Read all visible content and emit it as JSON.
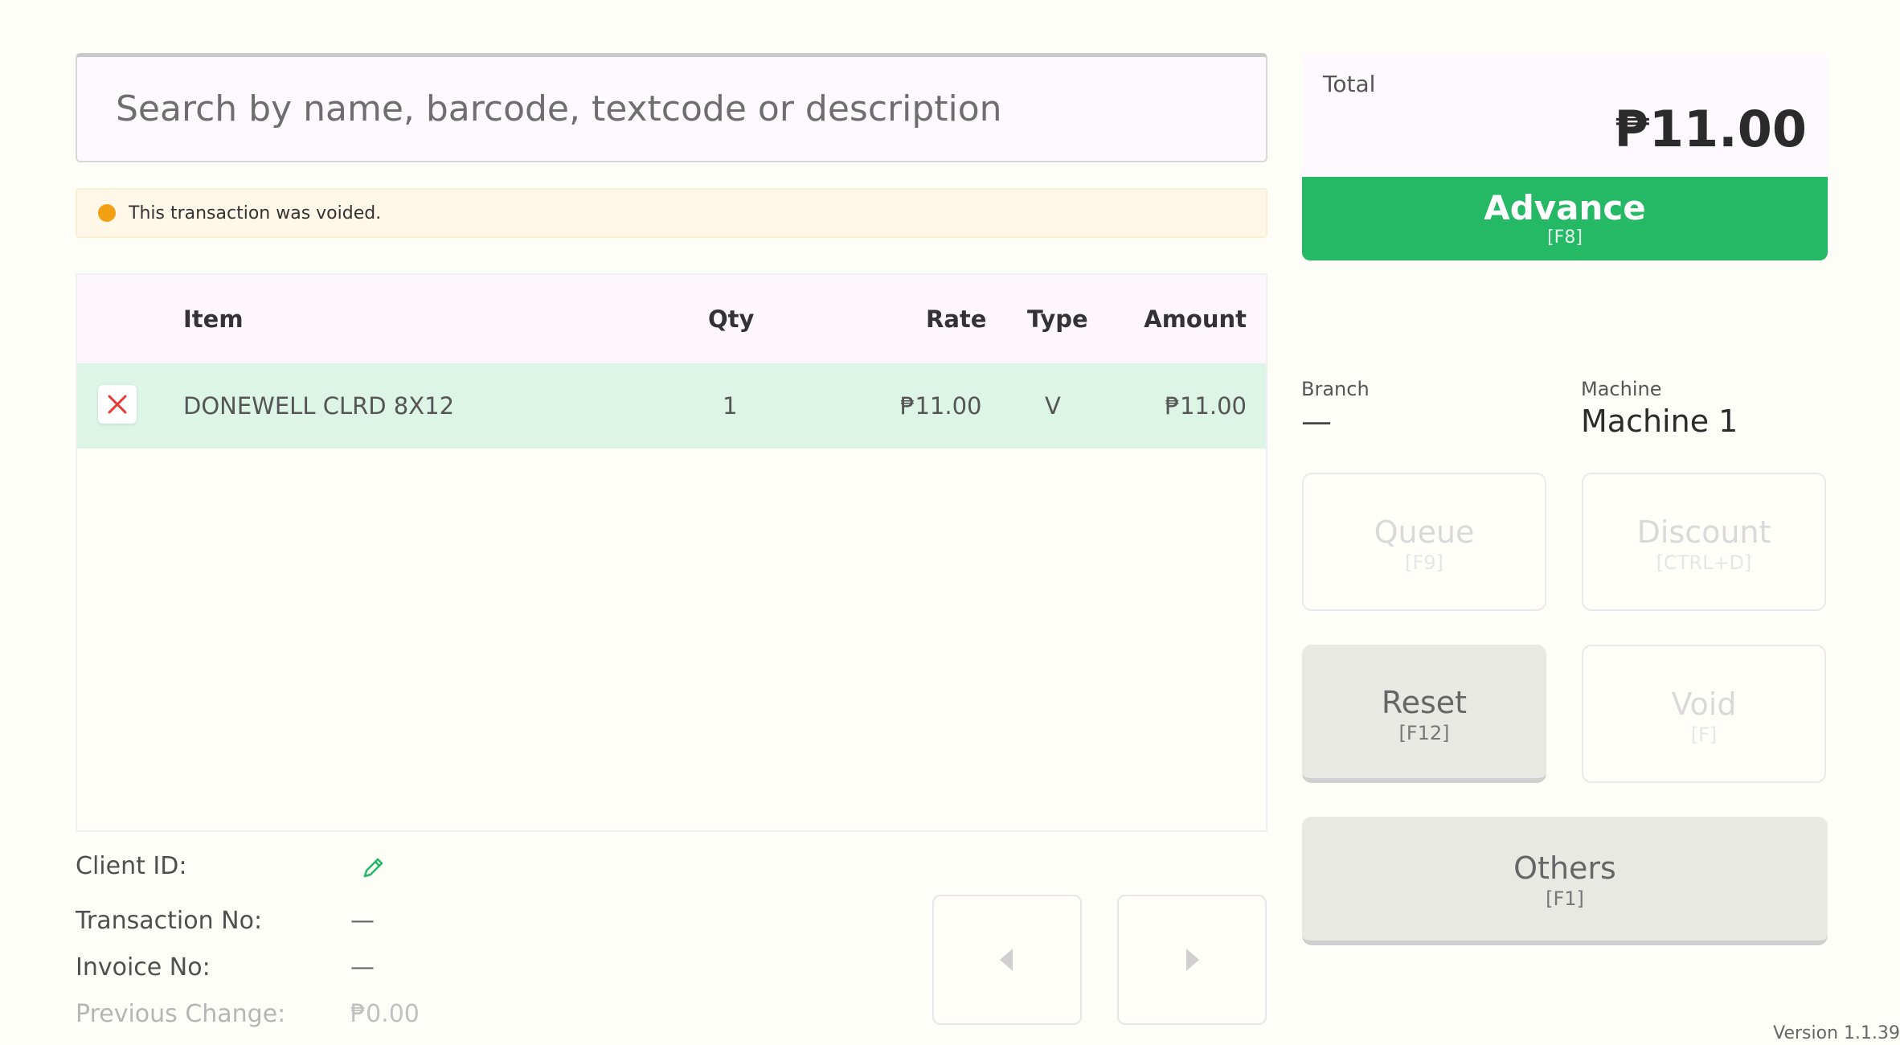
{
  "search": {
    "placeholder": "Search by name, barcode, textcode or description"
  },
  "alert": {
    "text": "This transaction was voided."
  },
  "table": {
    "headers": {
      "item": "Item",
      "qty": "Qty",
      "rate": "Rate",
      "type": "Type",
      "amount": "Amount"
    },
    "rows": [
      {
        "item": "DONEWELL CLRD 8X12",
        "qty": "1",
        "rate": "₱11.00",
        "type": "V",
        "amount": "₱11.00"
      }
    ]
  },
  "client": {
    "client_id_label": "Client ID:",
    "transaction_no_label": "Transaction No:",
    "transaction_no_value": "—",
    "invoice_no_label": "Invoice No:",
    "invoice_no_value": "—",
    "previous_change_label": "Previous Change:",
    "previous_change_value": "₱0.00"
  },
  "summary": {
    "total_label": "Total",
    "total_value": "₱11.00"
  },
  "advance": {
    "label": "Advance",
    "key": "[F8]"
  },
  "meta": {
    "branch_label": "Branch",
    "branch_value": "—",
    "machine_label": "Machine",
    "machine_value": "Machine 1"
  },
  "actions": {
    "queue": {
      "label": "Queue",
      "key": "[F9]"
    },
    "discount": {
      "label": "Discount",
      "key": "[CTRL+D]"
    },
    "reset": {
      "label": "Reset",
      "key": "[F12]"
    },
    "void": {
      "label": "Void",
      "key": "[F]"
    },
    "others": {
      "label": "Others",
      "key": "[F1]"
    }
  },
  "version": "Version 1.1.39",
  "colors": {
    "accent_green": "#25b865",
    "row_highlight": "#dcf5e6",
    "alert_bg": "#fff8e9",
    "alert_dot": "#f4a014",
    "remove_icon": "#e53935"
  },
  "icons": {
    "remove": "close-icon",
    "edit": "pencil-icon",
    "prev": "chevron-left-icon",
    "next": "chevron-right-icon"
  }
}
